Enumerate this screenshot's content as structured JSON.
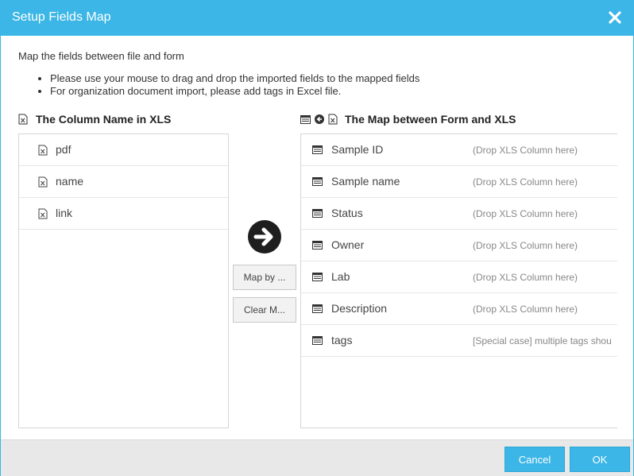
{
  "dialog": {
    "title": "Setup Fields Map",
    "intro": "Map the fields between file and form",
    "bullets": [
      "Please use your mouse to drag and drop the imported fields to the mapped fields",
      "For organization document import, please add tags in Excel file."
    ]
  },
  "left": {
    "heading": "The Column Name in XLS",
    "columns": [
      "pdf",
      "name",
      "link"
    ]
  },
  "right": {
    "heading": "The Map between Form and XLS",
    "fields": [
      {
        "label": "Sample ID",
        "hint": "(Drop XLS Column here)"
      },
      {
        "label": "Sample name",
        "hint": "(Drop XLS Column here)"
      },
      {
        "label": "Status",
        "hint": "(Drop XLS Column here)"
      },
      {
        "label": "Owner",
        "hint": "(Drop XLS Column here)"
      },
      {
        "label": "Lab",
        "hint": "(Drop XLS Column here)"
      },
      {
        "label": "Description",
        "hint": "(Drop XLS Column here)"
      },
      {
        "label": "tags",
        "hint": "[Special case] multiple tags shou"
      }
    ]
  },
  "middle": {
    "map_by_label": "Map by ...",
    "clear_label": "Clear M..."
  },
  "footer": {
    "cancel_label": "Cancel",
    "ok_label": "OK"
  },
  "icons": {
    "close": "close-icon",
    "xls_file": "xls-file-icon",
    "form_field": "form-field-icon",
    "map_arrow": "arrow-right-circle-icon",
    "back_arrow": "arrow-left-circle-icon"
  },
  "colors": {
    "accent": "#3bb6e6",
    "footer_bg": "#e8e8e8"
  }
}
